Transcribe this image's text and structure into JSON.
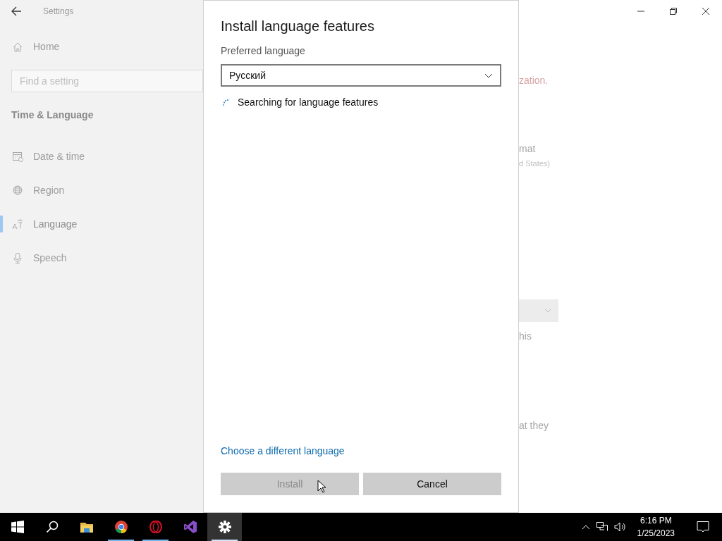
{
  "window": {
    "title": "Settings"
  },
  "sidebar": {
    "home": "Home",
    "search": {
      "placeholder": "Find a setting"
    },
    "section": "Time & Language",
    "items": [
      {
        "label": "Date & time",
        "selected": false
      },
      {
        "label": "Region",
        "selected": false
      },
      {
        "label": "Language",
        "selected": true
      },
      {
        "label": "Speech",
        "selected": false
      }
    ]
  },
  "background": [
    {
      "kind": "warning",
      "text": "zation."
    },
    {
      "kind": "heading",
      "text": "mat"
    },
    {
      "kind": "sub",
      "text": "d States)"
    },
    {
      "kind": "dropdown"
    },
    {
      "kind": "text",
      "text": "his"
    },
    {
      "kind": "text",
      "text": "at they"
    }
  ],
  "dialog": {
    "title": "Install language features",
    "label": "Preferred language",
    "value": "Русский",
    "status": "Searching for language features",
    "link": "Choose a different language",
    "buttons": [
      {
        "label": "Install",
        "disabled": true
      },
      {
        "label": "Cancel",
        "disabled": false
      }
    ]
  },
  "taskbar": {
    "apps": [
      {
        "running": false,
        "selected": false
      },
      {
        "running": false,
        "selected": false
      },
      {
        "running": false,
        "selected": false
      },
      {
        "running": true,
        "selected": false
      },
      {
        "running": true,
        "selected": false
      },
      {
        "running": false,
        "selected": false
      },
      {
        "running": true,
        "selected": true
      }
    ],
    "time": "6:16 PM",
    "date": "1/25/2023"
  }
}
